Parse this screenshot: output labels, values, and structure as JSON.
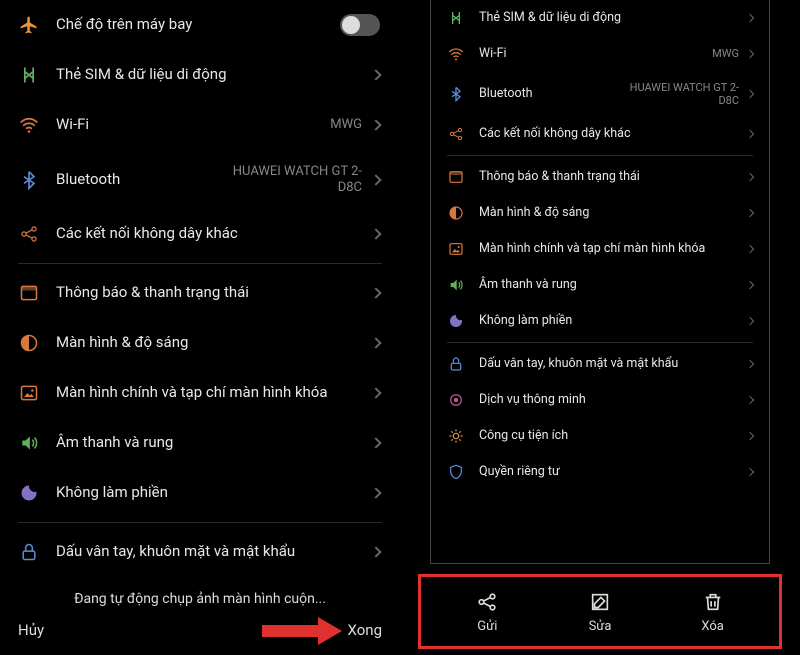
{
  "left": {
    "items": [
      {
        "icon": "airplane",
        "label": "Chế độ trên máy bay",
        "kind": "toggle"
      },
      {
        "icon": "sim",
        "label": "Thẻ SIM & dữ liệu di động",
        "kind": "nav"
      },
      {
        "icon": "wifi",
        "label": "Wi-Fi",
        "value": "MWG",
        "kind": "nav"
      },
      {
        "icon": "bluetooth",
        "label": "Bluetooth",
        "value": "HUAWEI WATCH GT 2-D8C",
        "kind": "nav"
      },
      {
        "icon": "wireless",
        "label": "Các kết nối không dây khác",
        "kind": "nav"
      },
      {
        "divider": true
      },
      {
        "icon": "notification",
        "label": "Thông báo & thanh trạng thái",
        "kind": "nav"
      },
      {
        "icon": "display",
        "label": "Màn hình & độ sáng",
        "kind": "nav"
      },
      {
        "icon": "wallpaper",
        "label": "Màn hình chính và tạp chí màn hình khóa",
        "kind": "nav"
      },
      {
        "icon": "sound",
        "label": "Âm thanh và rung",
        "kind": "nav"
      },
      {
        "icon": "dnd",
        "label": "Không làm phiền",
        "kind": "nav"
      },
      {
        "divider": true
      },
      {
        "icon": "lock",
        "label": "Dấu vân tay, khuôn mặt và mật khẩu",
        "kind": "nav"
      }
    ],
    "status": "Đang tự động chụp ảnh màn hình cuộn...",
    "cancel": "Hủy",
    "done": "Xong"
  },
  "right": {
    "items": [
      {
        "icon": "sim",
        "label": "Thẻ SIM & dữ liệu di động",
        "kind": "nav"
      },
      {
        "icon": "wifi",
        "label": "Wi-Fi",
        "value": "MWG",
        "kind": "nav"
      },
      {
        "icon": "bluetooth",
        "label": "Bluetooth",
        "value": "HUAWEI WATCH GT 2-D8C",
        "kind": "nav"
      },
      {
        "icon": "wireless",
        "label": "Các kết nối không dây khác",
        "kind": "nav"
      },
      {
        "divider": true
      },
      {
        "icon": "notification",
        "label": "Thông báo & thanh trạng thái",
        "kind": "nav"
      },
      {
        "icon": "display",
        "label": "Màn hình & độ sáng",
        "kind": "nav"
      },
      {
        "icon": "wallpaper",
        "label": "Màn hình chính và tạp chí màn hình khóa",
        "kind": "nav"
      },
      {
        "icon": "sound",
        "label": "Âm thanh và rung",
        "kind": "nav"
      },
      {
        "icon": "dnd",
        "label": "Không làm phiền",
        "kind": "nav"
      },
      {
        "divider": true
      },
      {
        "icon": "lock",
        "label": "Dấu vân tay, khuôn mặt và mật khẩu",
        "kind": "nav"
      },
      {
        "icon": "smart",
        "label": "Dịch vụ thông minh",
        "kind": "nav"
      },
      {
        "icon": "tools",
        "label": "Công cụ tiện ích",
        "kind": "nav"
      },
      {
        "icon": "privacy",
        "label": "Quyền riêng tư",
        "kind": "nav"
      }
    ],
    "actions": [
      {
        "icon": "share",
        "label": "Gửi"
      },
      {
        "icon": "edit",
        "label": "Sửa"
      },
      {
        "icon": "delete",
        "label": "Xóa"
      }
    ]
  },
  "colors": {
    "airplane": "#e8943a",
    "sim": "#5fb35f",
    "wifi": "#d87840",
    "bluetooth": "#5a8dd6",
    "wireless": "#d87840",
    "notification": "#d87840",
    "display": "#d87840",
    "wallpaper": "#d87840",
    "sound": "#5fb35f",
    "dnd": "#8470c4",
    "lock": "#5a8dd6",
    "smart": "#c05a9e",
    "tools": "#d8a040",
    "privacy": "#5a8dd6"
  }
}
